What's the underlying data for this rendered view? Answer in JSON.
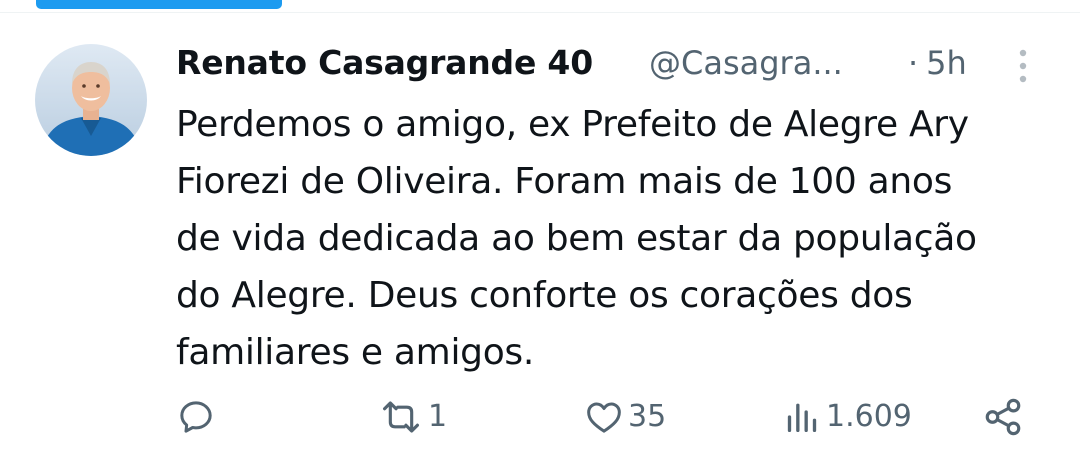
{
  "tweet": {
    "display_name": "Renato Casagrande 40",
    "handle": "@Casagra...",
    "separator": "·",
    "time_ago": "5h",
    "text": "Perdemos o amigo, ex Prefeito de Alegre Ary\nFiorezi de Oliveira. Foram mais de 100 anos\nde vida dedicada ao bem estar da população\ndo Alegre. Deus conforte os corações dos\nfamiliares e amigos."
  },
  "actions": {
    "reply_count": "",
    "retweet_count": "1",
    "like_count": "35",
    "views_count": "1.609"
  },
  "icons": {
    "avatar": "avatar",
    "more": "more-vertical-icon",
    "reply": "reply-icon",
    "retweet": "retweet-icon",
    "like": "heart-icon",
    "views": "views-icon",
    "share": "share-icon"
  },
  "colors": {
    "accent": "#1d9bf0",
    "text_primary": "#0f1419",
    "text_secondary": "#536471",
    "divider": "#eff3f4"
  }
}
